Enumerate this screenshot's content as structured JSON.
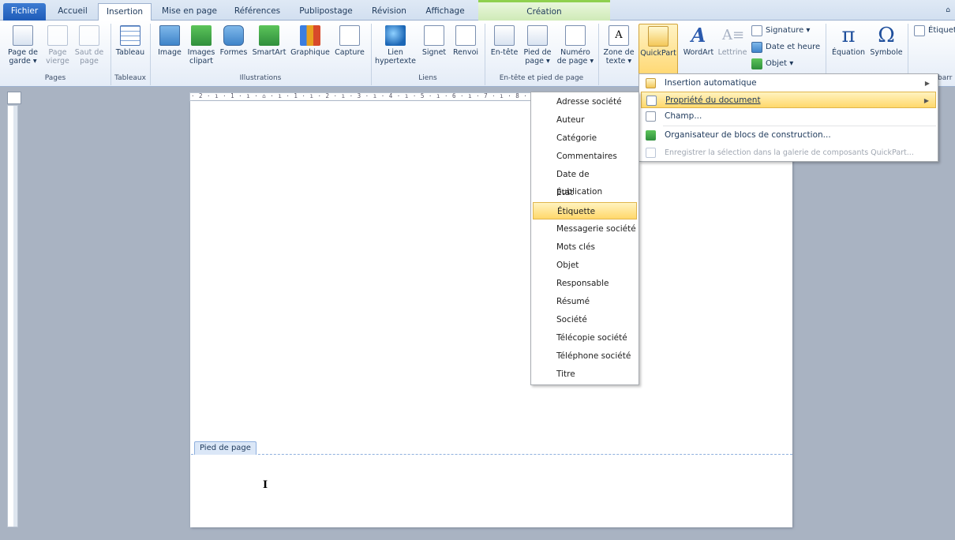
{
  "tabs": {
    "fichier": "Fichier",
    "accueil": "Accueil",
    "insertion": "Insertion",
    "mise_en_page": "Mise en page",
    "references": "Références",
    "publipostage": "Publipostage",
    "revision": "Révision",
    "affichage": "Affichage",
    "creation": "Création"
  },
  "ribbon": {
    "pages": {
      "label": "Pages",
      "page_de_garde": "Page de garde ▾",
      "page_vierge": "Page vierge",
      "saut_de_page": "Saut de page"
    },
    "tableaux": {
      "label": "Tableaux",
      "tableau": "Tableau"
    },
    "illustrations": {
      "label": "Illustrations",
      "image": "Image",
      "images_clipart": "Images clipart",
      "formes": "Formes",
      "smartart": "SmartArt",
      "graphique": "Graphique",
      "capture": "Capture"
    },
    "liens": {
      "label": "Liens",
      "lien_hypertexte": "Lien hypertexte",
      "signet": "Signet",
      "renvoi": "Renvoi"
    },
    "entete": {
      "label": "En-tête et pied de page",
      "en_tete": "En-tête",
      "pied_de_page": "Pied de page ▾",
      "numero_de_page": "Numéro de page ▾"
    },
    "texte": {
      "zone_de_texte": "Zone de texte ▾",
      "quickpart": "QuickPart",
      "wordart": "WordArt",
      "lettrine": "Lettrine",
      "signature": "Signature ▾",
      "date_et_heure": "Date et heure",
      "objet": "Objet ▾"
    },
    "symboles": {
      "equation": "Équation",
      "symbole": "Symbole"
    },
    "etiquette_partial": "Étiquet",
    "barre_partial": "barr"
  },
  "ruler_ticks": "· 2 · ı · 1 · ı · ⌂ · ı · 1 · ı · 2 · ı · 3 · ı · 4 · ı · 5 · ı · 6 · ı · 7 · ı · 8 · ı · 9 ·",
  "document": {
    "footer_tab": "Pied de page"
  },
  "quickpart_menu": [
    {
      "label": "Insertion automatique",
      "submenu": true
    },
    {
      "label": "Propriété du document",
      "submenu": true
    },
    {
      "label": "Champ..."
    },
    {
      "label": "Organisateur de blocs de construction..."
    },
    {
      "label": "Enregistrer la sélection dans la galerie de composants QuickPart..."
    }
  ],
  "property_menu": [
    "Adresse société",
    "Auteur",
    "Catégorie",
    "Commentaires",
    "Date de publication",
    "État",
    "Étiquette",
    "Messagerie société",
    "Mots clés",
    "Objet",
    "Responsable",
    "Résumé",
    "Société",
    "Télécopie société",
    "Téléphone société",
    "Titre"
  ],
  "colors": {
    "accent": "#1f5cb8",
    "highlight": "#ffd86b",
    "contextual_tab": "#8fd04e"
  }
}
